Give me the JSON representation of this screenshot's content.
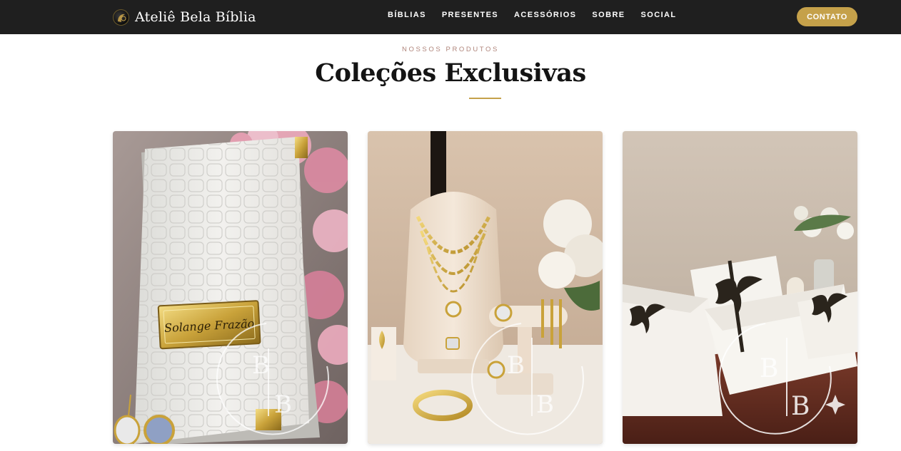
{
  "header": {
    "brand_name": "Ateliê Bela Bíblia",
    "nav": [
      "BÍBLIAS",
      "PRESENTES",
      "ACESSÓRIOS",
      "SOBRE",
      "SOCIAL"
    ],
    "contact_label": "CONTATO"
  },
  "section": {
    "eyebrow": "NOSSOS PRODUTOS",
    "title": "Coleções Exclusivas"
  },
  "cards": [
    {
      "photo": "bible-photo",
      "nameplate": "Solange Frazão"
    },
    {
      "photo": "jewelry-photo"
    },
    {
      "photo": "gift-boxes-photo"
    }
  ],
  "colors": {
    "header_bg": "#1f1f1f",
    "accent_gold": "#c5a14a",
    "eyebrow": "#b0857b",
    "title": "#141414"
  }
}
